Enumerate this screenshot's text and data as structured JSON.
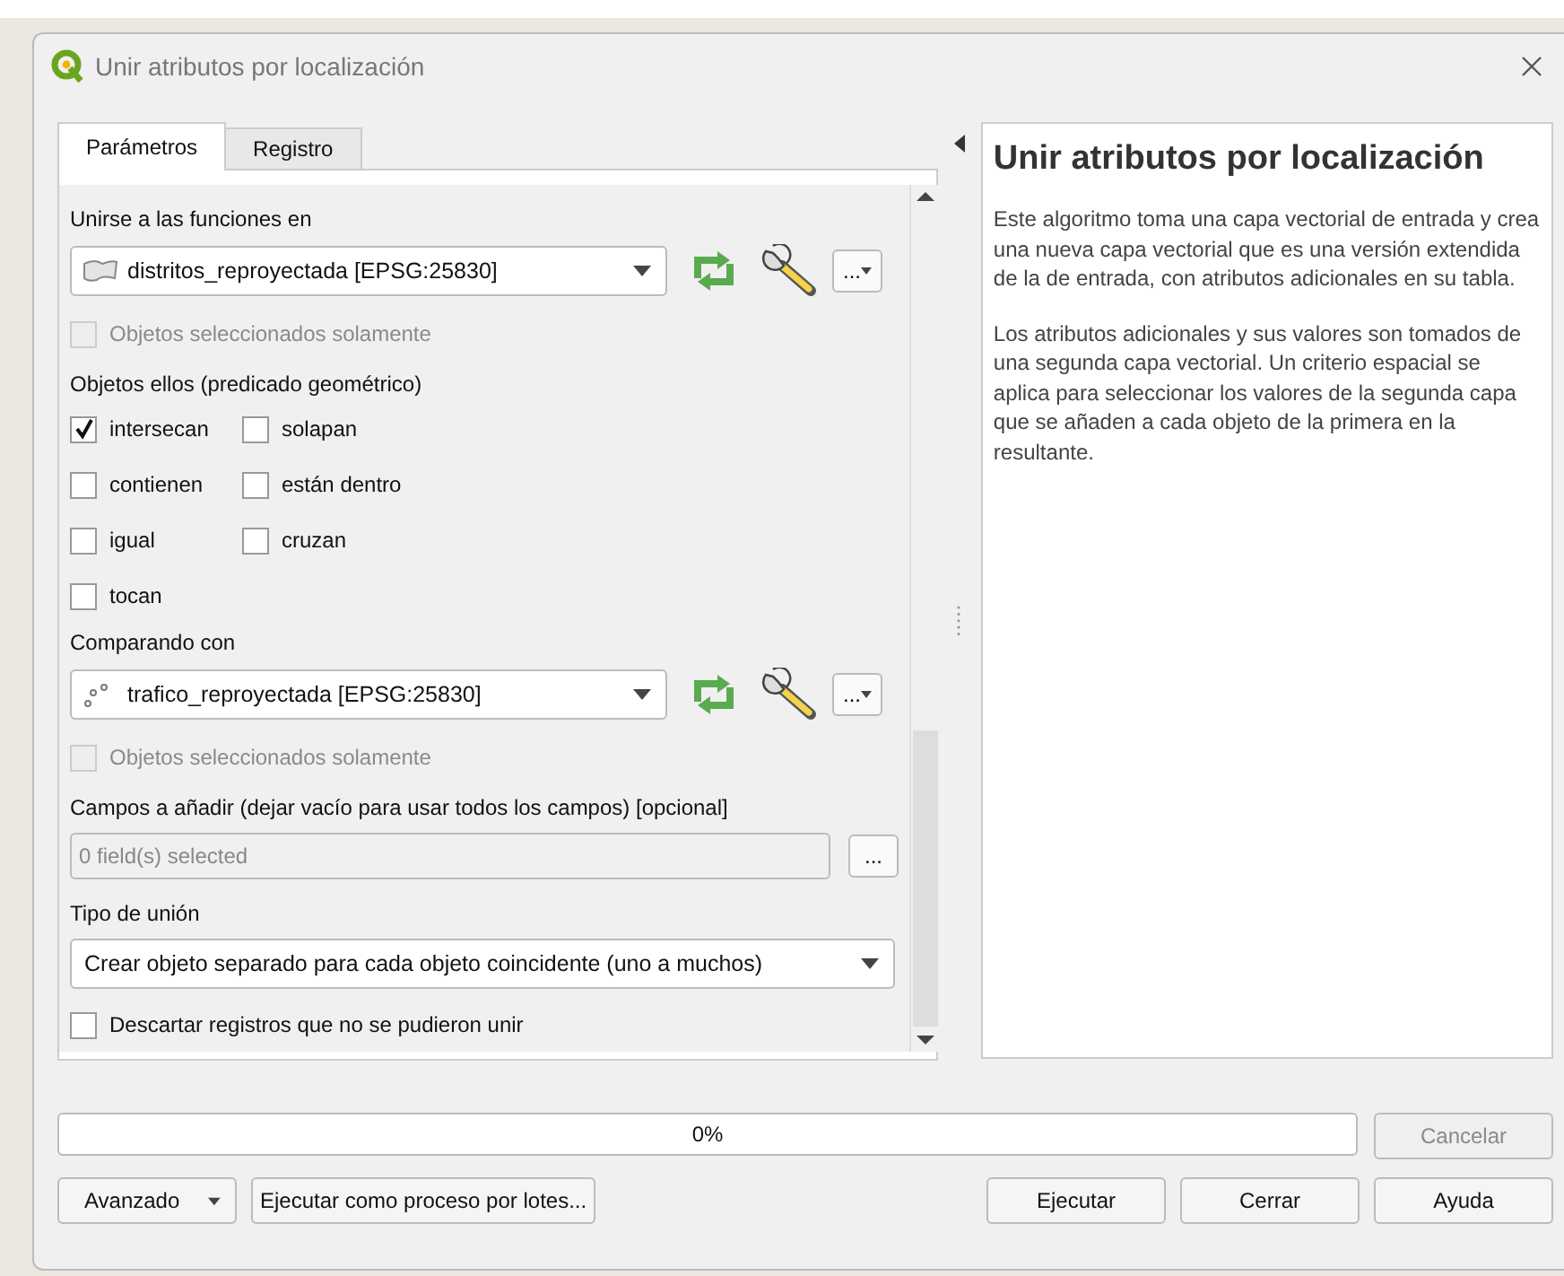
{
  "window": {
    "title": "Unir atributos por localización"
  },
  "tabs": [
    {
      "label": "Parámetros",
      "selected": true
    },
    {
      "label": "Registro",
      "selected": false
    }
  ],
  "params": {
    "input_layer": {
      "label": "Unirse a las funciones en",
      "value": "distritos_reproyectada [EPSG:25830]",
      "kind": "polygon",
      "more": "...",
      "selected_only": {
        "label": "Objetos seleccionados solamente",
        "checked": false,
        "disabled": true
      }
    },
    "predicate": {
      "label": "Objetos ellos (predicado geométrico)",
      "options": [
        {
          "label": "intersecan",
          "checked": true
        },
        {
          "label": "solapan",
          "checked": false
        },
        {
          "label": "contienen",
          "checked": false
        },
        {
          "label": "están dentro",
          "checked": false
        },
        {
          "label": "igual",
          "checked": false
        },
        {
          "label": "cruzan",
          "checked": false
        },
        {
          "label": "tocan",
          "checked": false
        }
      ]
    },
    "join_layer": {
      "label": "Comparando con",
      "value": "trafico_reproyectada [EPSG:25830]",
      "kind": "point",
      "more": "...",
      "selected_only": {
        "label": "Objetos seleccionados solamente",
        "checked": false,
        "disabled": true
      }
    },
    "fields": {
      "label": "Campos a añadir (dejar vacío para usar todos los campos) [opcional]",
      "placeholder": "0 field(s) selected",
      "button": "..."
    },
    "join_type": {
      "label": "Tipo de unión",
      "value": "Crear objeto separado para cada objeto coincidente (uno a muchos)"
    },
    "discard": {
      "label": "Descartar registros que no se pudieron unir",
      "checked": false,
      "disabled": false
    }
  },
  "help": {
    "title": "Unir atributos por localización",
    "paragraphs": [
      "Este algoritmo toma una capa vectorial de entrada y crea una nueva capa vectorial que es una versión extendida de la de entrada, con atributos adicionales en su tabla.",
      "Los atributos adicionales y sus valores son tomados de una segunda capa vectorial. Un criterio espacial se aplica para seleccionar los valores de la segunda capa que se añaden a cada objeto de la primera en la resultante."
    ]
  },
  "progress": {
    "level": 0,
    "reading": "0%",
    "cancel": {
      "label": "Cancelar",
      "disabled": true
    }
  },
  "footer": {
    "left": [
      {
        "label": "Avanzado",
        "kind": "menu"
      },
      {
        "label": "Ejecutar como proceso por lotes...",
        "kind": "plain"
      }
    ],
    "right": [
      {
        "label": "Ejecutar",
        "kind": "plain"
      },
      {
        "label": "Cerrar",
        "kind": "plain"
      },
      {
        "label": "Ayuda",
        "kind": "plain"
      }
    ]
  }
}
